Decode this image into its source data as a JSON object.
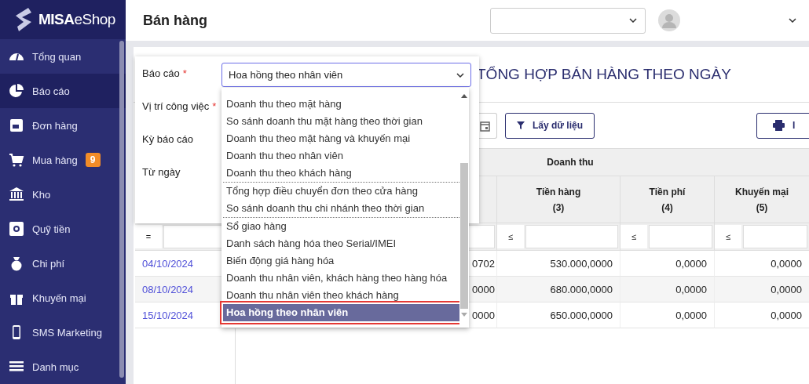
{
  "logo": {
    "text": "**MISA**eShop"
  },
  "sidebar": {
    "items": [
      {
        "label": "Tổng quan",
        "selected": false
      },
      {
        "label": "Báo cáo",
        "selected": true
      },
      {
        "label": "Đơn hàng",
        "selected": false
      },
      {
        "label": "Mua hàng",
        "selected": false,
        "badge": "9"
      },
      {
        "label": "Kho",
        "selected": false
      },
      {
        "label": "Quỹ tiền",
        "selected": false
      },
      {
        "label": "Chi phí",
        "selected": false
      },
      {
        "label": "Khuyến mại",
        "selected": false
      },
      {
        "label": "SMS Marketing",
        "selected": false
      },
      {
        "label": "Danh mục",
        "selected": false
      }
    ]
  },
  "header": {
    "title": "Bán hàng"
  },
  "report": {
    "title": "TỔNG HỢP BÁN HÀNG THEO NGÀY"
  },
  "toolbar": {
    "buttons": [
      {
        "kind": "filter",
        "label": "Lấy dữ liệu"
      },
      {
        "kind": "print",
        "label": "I"
      }
    ]
  },
  "table": {
    "group_header": "Doanh thu",
    "columns": [
      {
        "label": "Tiền hàng",
        "number": "(3)"
      },
      {
        "label": "Tiền phí",
        "number": "(4)"
      },
      {
        "label": "Khuyến mại",
        "number": "(5)"
      }
    ],
    "date_filter": "=",
    "value_filter": "≤",
    "rows": [
      {
        "date": "04/10/2024",
        "column_3": "0702",
        "values": [
          "530.000,0000",
          "0,0000",
          "0,0000"
        ]
      },
      {
        "date": "08/10/2024",
        "column_3": "0000",
        "values": [
          "680.000,0000",
          "0,0000",
          "0,0000"
        ]
      },
      {
        "date": "15/10/2024",
        "column_3": "0000",
        "values": [
          "650.000,0000",
          "0,0000",
          "0,0000"
        ]
      }
    ]
  },
  "filter_panel": {
    "fields": [
      {
        "label": "Báo cáo",
        "mark": "*"
      },
      {
        "label": "Vị trí công việc",
        "mark": "*"
      },
      {
        "label": "Kỳ báo cáo"
      },
      {
        "label": "Từ ngày"
      }
    ],
    "report_select": {
      "value": "Hoa hồng theo nhân viên"
    },
    "dropdown": {
      "groups": [
        [
          {
            "label": "Doanh thu theo mặt hàng",
            "selected": false
          },
          {
            "label": "So sánh doanh thu mặt hàng theo thời gian",
            "selected": false
          },
          {
            "label": "Doanh thu theo mặt hàng và khuyến mại",
            "selected": false
          },
          {
            "label": "Doanh thu theo nhân viên",
            "selected": false
          },
          {
            "label": "Doanh thu theo khách hàng",
            "selected": false
          }
        ],
        [
          {
            "label": "Tổng hợp điều chuyển đơn theo cửa hàng",
            "selected": false
          },
          {
            "label": "So sánh doanh thu chi nhánh theo thời gian",
            "selected": false
          }
        ],
        [
          {
            "label": "Sổ giao hàng",
            "selected": false
          },
          {
            "label": "Danh sách hàng hóa theo Serial/IMEI",
            "selected": false
          },
          {
            "label": "Biến động giá hàng hóa",
            "selected": false
          },
          {
            "label": "Doanh thu nhân viên, khách hàng theo hàng hóa",
            "selected": false
          },
          {
            "label": "Doanh thu nhân viên theo khách hàng",
            "selected": false
          },
          {
            "label": "Hoa hồng theo nhân viên",
            "selected": true
          }
        ]
      ]
    }
  }
}
